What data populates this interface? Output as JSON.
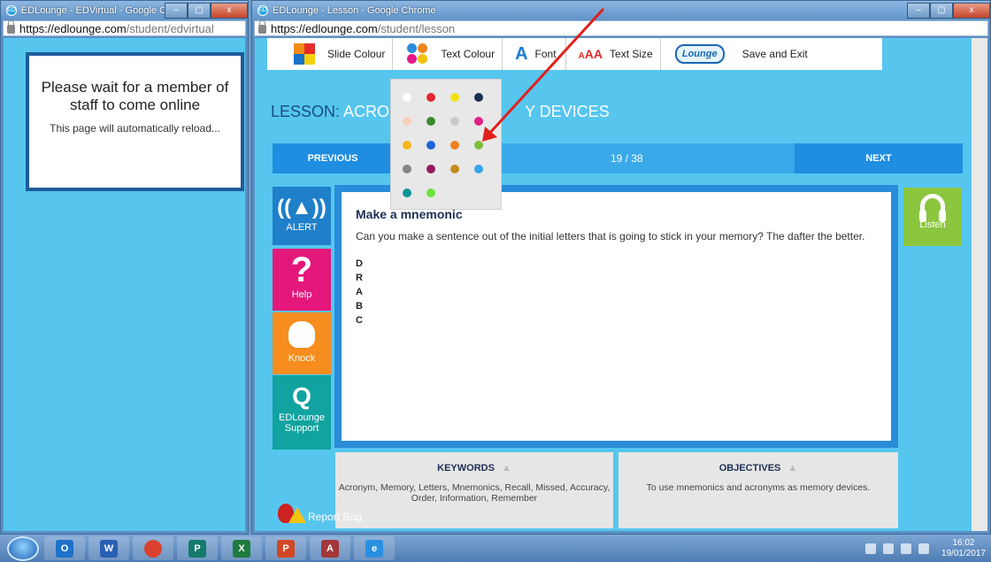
{
  "left_window": {
    "title": "EDLounge - EDVirtual - Google Chro...",
    "url_host": "https://edlounge.com",
    "url_path": "/student/edvirtual",
    "message": "Please wait for a member of staff to come online",
    "sub_message": "This page will automatically reload..."
  },
  "right_window": {
    "title": "EDLounge - Lesson - Google Chrome",
    "url_host": "https://edlounge.com",
    "url_path": "/student/lesson"
  },
  "window_controls": {
    "minimize": "–",
    "maximize": "▢",
    "close": "x"
  },
  "toolbar": {
    "slide_colour": "Slide Colour",
    "text_colour": "Text Colour",
    "font": "Font",
    "font_icon": "A",
    "text_size": "Text Size",
    "text_size_icon_small": "A",
    "text_size_icon_large": "AA",
    "logo": "Lounge",
    "save_exit": "Save and Exit"
  },
  "lesson": {
    "title_prefix": "LESSON: ",
    "title_visible_left": "ACRON",
    "title_visible_right": "Y DEVICES",
    "prev": "PREVIOUS",
    "next": "NEXT",
    "page": "19 / 38"
  },
  "sidebar": {
    "alert": "ALERT",
    "alert_icon": "alarm-icon",
    "help": "Help",
    "help_symbol": "?",
    "knock": "Knock",
    "support": "EDLounge Support",
    "support_symbol": "Q"
  },
  "listen": "Listen",
  "content": {
    "heading": "Make a mnemonic",
    "body": "Can you make a sentence out of the initial letters that is going to stick in your memory? The dafter the better.",
    "letters": [
      "D",
      "R",
      "A",
      "B",
      "C"
    ]
  },
  "keywords": {
    "title": "KEYWORDS",
    "text": "Acronym, Memory, Letters, Mnemonics, Recall, Missed, Accuracy, Order, Information, Remember"
  },
  "objectives": {
    "title": "OBJECTIVES",
    "text": "To use mnemonics and acronyms as memory devices."
  },
  "report_bug": "Report Bug",
  "colour_picker": [
    "#ffffff",
    "#e3262d",
    "#f1e111",
    "#1c2f54",
    "#f7d1bd",
    "#3a8b2c",
    "#c9c9c9",
    "#e41f84",
    "#f5b41a",
    "#1f63d6",
    "#f07f1e",
    "#7cbd3a",
    "#858585",
    "#941a5d",
    "#c38c1d",
    "#35a6e8",
    "#0d9494",
    "#6ee23c"
  ],
  "taskbar": {
    "apps": [
      {
        "name": "outlook",
        "label": "O",
        "color": "#1e72c8"
      },
      {
        "name": "word",
        "label": "W",
        "color": "#2b5fb4"
      },
      {
        "name": "chrome",
        "label": "",
        "color": "#d9412f"
      },
      {
        "name": "publisher",
        "label": "P",
        "color": "#157a6e"
      },
      {
        "name": "excel",
        "label": "X",
        "color": "#1f7a3f"
      },
      {
        "name": "powerpoint",
        "label": "P",
        "color": "#d24726"
      },
      {
        "name": "access",
        "label": "A",
        "color": "#a4373a"
      },
      {
        "name": "internet-explorer",
        "label": "e",
        "color": "#2b8fe0"
      }
    ],
    "time": "16:02",
    "date": "19/01/2017"
  }
}
